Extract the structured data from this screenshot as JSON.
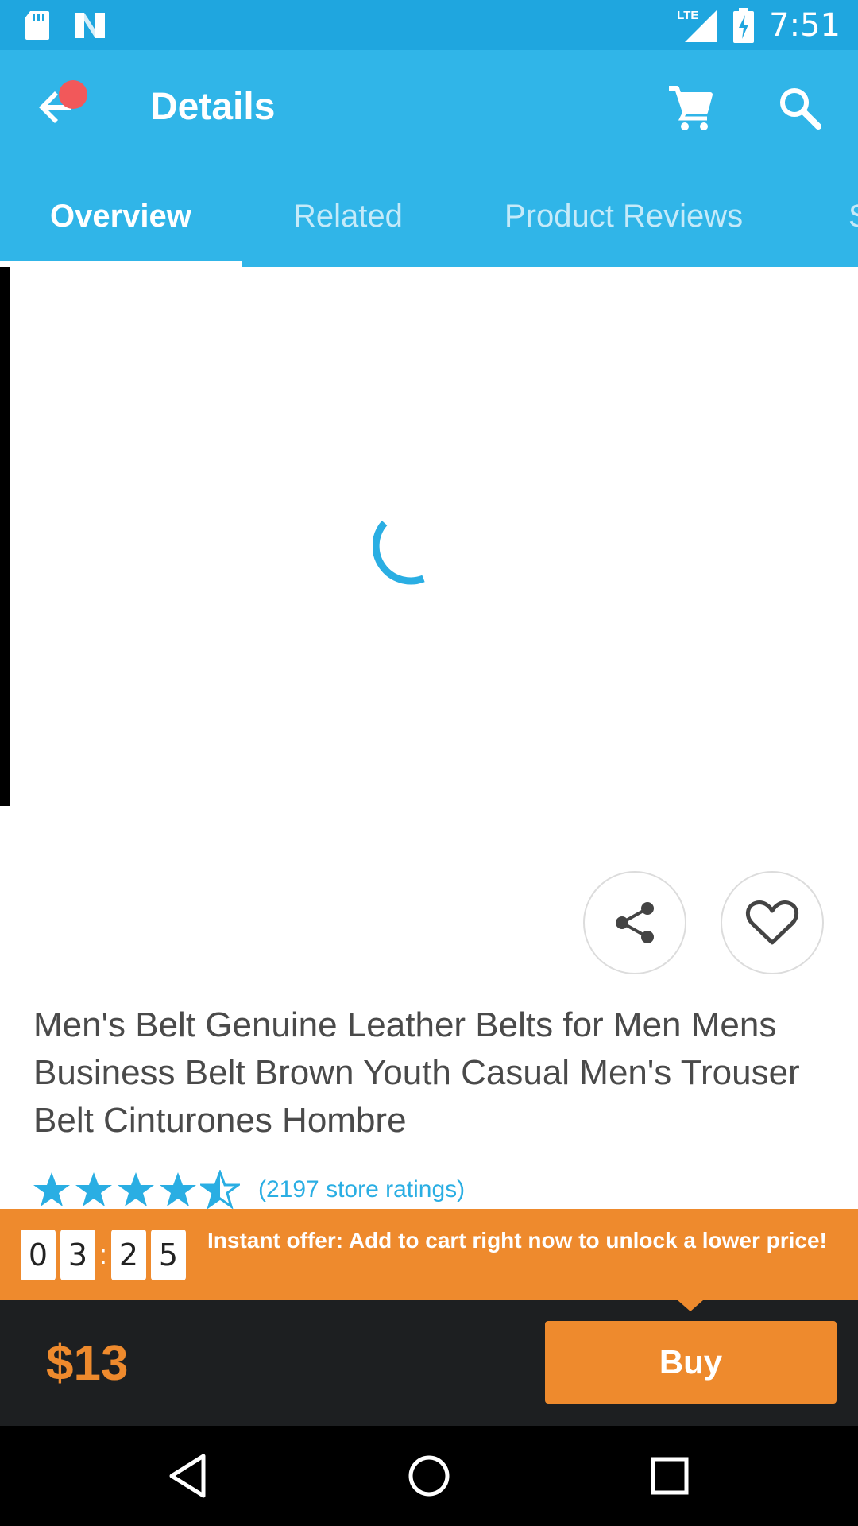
{
  "status_bar": {
    "time": "7:51",
    "network": "LTE",
    "icons": [
      "sd-card-icon",
      "n-notification-icon",
      "signal-icon",
      "battery-charging-icon"
    ]
  },
  "app_bar": {
    "title": "Details",
    "icons": [
      "back-arrow-icon",
      "cart-icon",
      "search-icon"
    ],
    "accent_color": "#30b5e8"
  },
  "tabs": [
    {
      "label": "Overview",
      "active": true
    },
    {
      "label": "Related",
      "active": false
    },
    {
      "label": "Product Reviews",
      "active": false
    },
    {
      "label": "S",
      "active": false
    }
  ],
  "product": {
    "title": "Men's Belt Genuine Leather Belts for Men Mens Business Belt Brown Youth Casual Men's Trouser Belt Cinturones Hombre",
    "rating": 4.5,
    "rating_max": 5,
    "ratings_text": "(2197 store ratings)"
  },
  "actions": {
    "icons": [
      "share-icon",
      "heart-icon"
    ]
  },
  "offer": {
    "timer_digits": [
      "0",
      "3",
      "2",
      "5"
    ],
    "separator": ":",
    "text": "Instant offer: Add to cart right now to unlock a lower price!",
    "color": "#ee8a2d"
  },
  "purchase": {
    "price": "$13",
    "buy_label": "Buy"
  },
  "nav_bar": {
    "icons": [
      "back-triangle-icon",
      "home-circle-icon",
      "recents-square-icon"
    ]
  }
}
